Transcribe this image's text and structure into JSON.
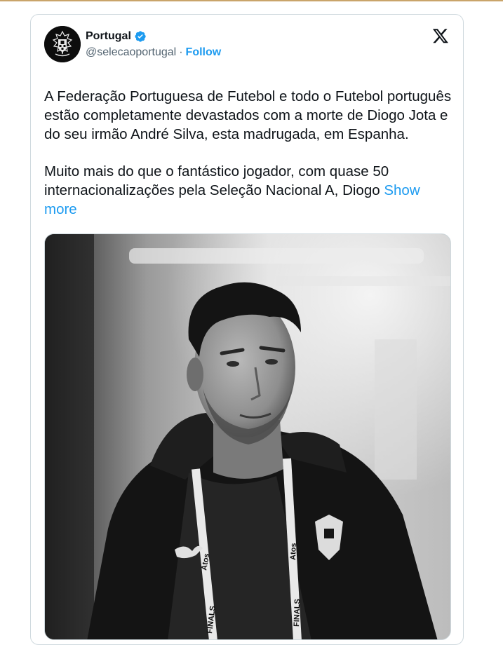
{
  "tweet": {
    "author_name": "Portugal",
    "handle": "@selecaoportugal",
    "separator": "·",
    "follow_label": "Follow",
    "paragraph_1": "A Federação Portuguesa de Futebol e todo o Futebol português estão completamente devastados com a morte de Diogo Jota e do seu irmão André Silva, esta madrugada, em Espanha.",
    "paragraph_2_start": "Muito mais do que o fantástico jogador, com quase 50 internacionalizações pela Seleção Nacional A, Diogo",
    "show_more_label": "Show more"
  },
  "media": {
    "lanyard_text_1": "Atos",
    "lanyard_text_2": "FINALS",
    "lanyard_text_3": "Atos",
    "lanyard_text_4": "FINALS"
  },
  "colors": {
    "accent": "#1d9bf0",
    "text": "#0f1419",
    "secondary": "#536471",
    "border": "#cfd9de",
    "top_rule": "#c9a46a"
  },
  "icons": [
    "fpf-crest-icon",
    "verified-badge-icon",
    "x-logo-icon"
  ]
}
